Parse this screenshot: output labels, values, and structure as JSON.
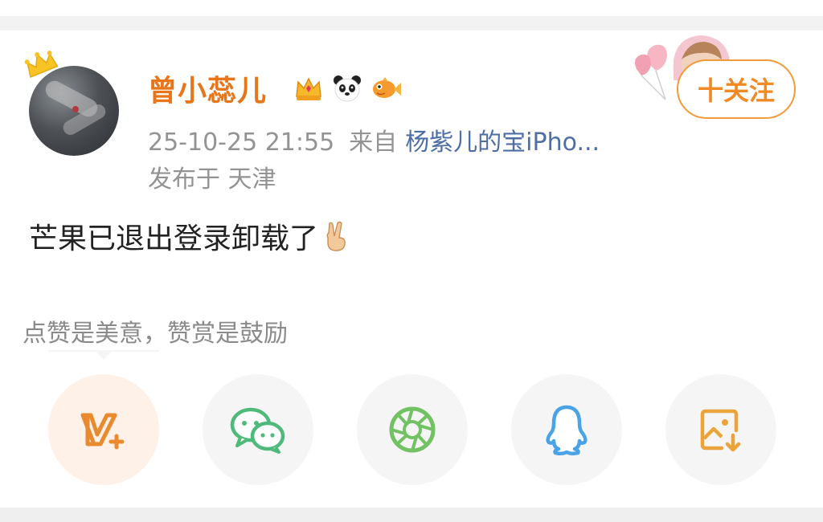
{
  "user": {
    "name": "曾小蕊儿",
    "badges": [
      "crown-badge-icon",
      "panda-badge-icon",
      "fish-badge-icon"
    ]
  },
  "post": {
    "time": "25-10-25 21:55",
    "from_label": "来自",
    "source": "杨紫儿的宝iPho...",
    "location": "发布于 天津",
    "content": "芒果已退出登录卸载了"
  },
  "follow_button": {
    "label": "十关注"
  },
  "reward_hint": "点赞是美意，赞赏是鼓励",
  "share_options": [
    {
      "name": "v-plus-reward",
      "icon": "v-plus-icon",
      "color": "#e98a2e"
    },
    {
      "name": "wechat",
      "icon": "wechat-icon",
      "color": "#4fba7b"
    },
    {
      "name": "moments",
      "icon": "camera-shutter-icon",
      "color": "#72c162"
    },
    {
      "name": "qq",
      "icon": "qq-penguin-icon",
      "color": "#4aa3e6"
    },
    {
      "name": "save-image",
      "icon": "save-image-icon",
      "color": "#eba43c"
    }
  ],
  "colors": {
    "username": "#e8751a",
    "meta": "#939393",
    "source_link": "#4e6ea6",
    "follow_border": "#f29a3a"
  }
}
